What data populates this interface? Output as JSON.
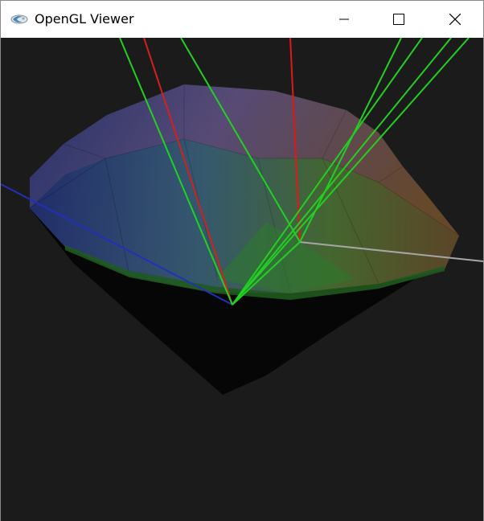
{
  "window": {
    "title": "OpenGL Viewer"
  },
  "titlebar": {
    "app_icon": "opengl-app-icon",
    "minimize_icon": "minimize-icon",
    "maximize_icon": "maximize-icon",
    "close_icon": "close-icon"
  },
  "viewport": {
    "background_color": "#1b1b1b",
    "scene": "3d-gem-with-rays"
  }
}
